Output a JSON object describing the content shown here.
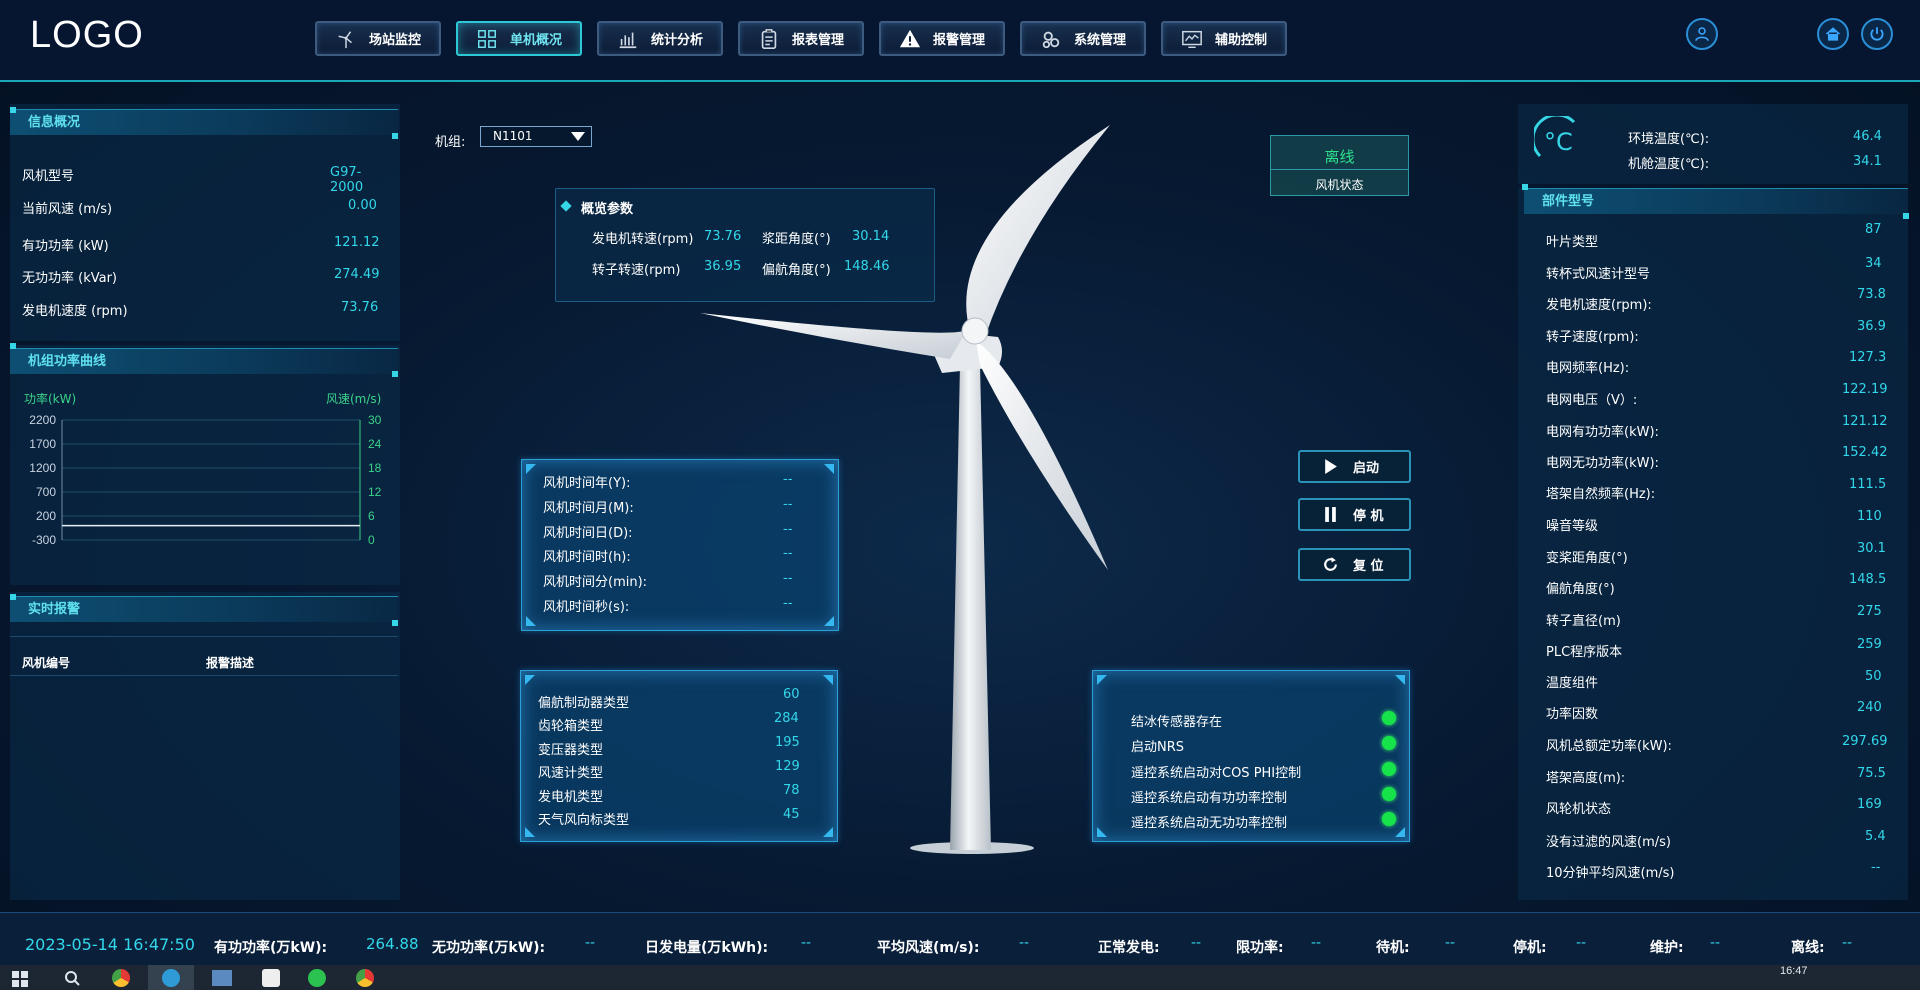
{
  "logo": "LOGO",
  "nav": [
    {
      "label": "场站监控",
      "icon": "wind-turbine-icon"
    },
    {
      "label": "单机概况",
      "icon": "grid-icon",
      "active": true
    },
    {
      "label": "统计分析",
      "icon": "bar-chart-icon"
    },
    {
      "label": "报表管理",
      "icon": "clipboard-icon"
    },
    {
      "label": "报警管理",
      "icon": "warning-icon"
    },
    {
      "label": "系统管理",
      "icon": "gears-icon"
    },
    {
      "label": "辅助控制",
      "icon": "monitor-chart-icon"
    }
  ],
  "info": {
    "title": "信息概况",
    "rows": [
      {
        "label": "风机型号",
        "value": "G97-2000"
      },
      {
        "label": "当前风速 (m/s)",
        "value": "0.00"
      },
      {
        "label": "有功功率 (kW)",
        "value": "121.12"
      },
      {
        "label": "无功功率 (kVar)",
        "value": "274.49"
      },
      {
        "label": "发电机速度 (rpm)",
        "value": "73.76"
      }
    ]
  },
  "power_curve": {
    "title": "机组功率曲线",
    "left_axis_label": "功率(kW)",
    "right_axis_label": "风速(m/s)"
  },
  "chart_data": {
    "type": "line",
    "title": "机组功率曲线",
    "ylabel": "功率(kW)",
    "y2label": "风速(m/s)",
    "yticks": [
      "2200",
      "1700",
      "1200",
      "700",
      "200",
      "-300"
    ],
    "y2ticks": [
      "30",
      "24",
      "18",
      "12",
      "6",
      "0"
    ],
    "ylim": [
      -300,
      2200
    ],
    "y2lim": [
      0,
      30
    ],
    "grid": true,
    "series": []
  },
  "alarm": {
    "title": "实时报警",
    "col_id": "风机编号",
    "col_desc": "报警描述"
  },
  "unit_select": {
    "label": "机组:",
    "value": "N1101"
  },
  "overview": {
    "title": "概览参数",
    "items": [
      {
        "label": "发电机转速(rpm)",
        "value": "73.76"
      },
      {
        "label": "浆距角度(°)",
        "value": "30.14"
      },
      {
        "label": "转子转速(rpm)",
        "value": "36.95"
      },
      {
        "label": "偏航角度(°)",
        "value": "148.46"
      }
    ]
  },
  "status": {
    "value": "离线",
    "label": "风机状态"
  },
  "time_box": [
    {
      "label": "风机时间年(Y):",
      "value": "--"
    },
    {
      "label": "风机时间月(M):",
      "value": "--"
    },
    {
      "label": "风机时间日(D):",
      "value": "--"
    },
    {
      "label": "风机时间时(h):",
      "value": "--"
    },
    {
      "label": "风机时间分(min):",
      "value": "--"
    },
    {
      "label": "风机时间秒(s):",
      "value": "--"
    }
  ],
  "types_box": [
    {
      "label": "偏航制动器类型",
      "value": "60"
    },
    {
      "label": "齿轮箱类型",
      "value": "284"
    },
    {
      "label": "变压器类型",
      "value": "195"
    },
    {
      "label": "风速计类型",
      "value": "129"
    },
    {
      "label": "发电机类型",
      "value": "78"
    },
    {
      "label": "天气风向标类型",
      "value": "45"
    }
  ],
  "controls": {
    "start": "启动",
    "stop": "停 机",
    "reset": "复 位"
  },
  "indicators": [
    {
      "label": "结冰传感器存在",
      "color": "#16e34a"
    },
    {
      "label": "启动NRS",
      "color": "#16e34a"
    },
    {
      "label": "遥控系统启动对COS PHI控制",
      "color": "#16e34a"
    },
    {
      "label": "遥控系统启动有功功率控制",
      "color": "#16e34a"
    },
    {
      "label": "遥控系统启动无功功率控制",
      "color": "#16e34a"
    }
  ],
  "temps": {
    "unit_symbol": "°C",
    "env_label": "环境温度(℃):",
    "env_value": "46.4",
    "cabin_label": "机舱温度(℃):",
    "cabin_value": "34.1"
  },
  "parts": {
    "title": "部件型号",
    "rows": [
      {
        "label": "叶片类型",
        "value": "87"
      },
      {
        "label": "转杯式风速计型号",
        "value": "34"
      },
      {
        "label": "发电机速度(rpm):",
        "value": "73.8"
      },
      {
        "label": "转子速度(rpm):",
        "value": "36.9"
      },
      {
        "label": "电网频率(Hz):",
        "value": "127.3"
      },
      {
        "label": "电网电压（V）:",
        "value": "122.19"
      },
      {
        "label": "电网有功功率(kW):",
        "value": "121.12"
      },
      {
        "label": "电网无功功率(kW):",
        "value": "152.42"
      },
      {
        "label": "塔架自然频率(Hz):",
        "value": "111.5"
      },
      {
        "label": "噪音等级",
        "value": "110"
      },
      {
        "label": "变桨距角度(°)",
        "value": "30.1"
      },
      {
        "label": "偏航角度(°)",
        "value": "148.5"
      },
      {
        "label": "转子直径(m)",
        "value": "275"
      },
      {
        "label": "PLC程序版本",
        "value": "259"
      },
      {
        "label": "温度组件",
        "value": "50"
      },
      {
        "label": "功率因数",
        "value": "240"
      },
      {
        "label": "风机总额定功率(kW):",
        "value": "297.69"
      },
      {
        "label": "塔架高度(m):",
        "value": "75.5"
      },
      {
        "label": "风轮机状态",
        "value": "169"
      },
      {
        "label": "没有过滤的风速(m/s)",
        "value": "5.4"
      },
      {
        "label": "10分钟平均风速(m/s)",
        "value": "--"
      }
    ]
  },
  "footer": {
    "datetime": "2023-05-14 16:47:50",
    "active_label": "有功功率(万kW):",
    "active_value": "264.88",
    "reactive_label": "无功功率(万kW):",
    "reactive_value": "--",
    "daily_label": "日发电量(万kWh):",
    "daily_value": "--",
    "wind_label": "平均风速(m/s):",
    "wind_value": "--",
    "normal_label": "正常发电:",
    "normal_value": "--",
    "limit_label": "限功率:",
    "limit_value": "--",
    "standby_label": "待机:",
    "standby_value": "--",
    "stop_label": "停机:",
    "stop_value": "--",
    "maint_label": "维护:",
    "maint_value": "--",
    "offline_label": "离线:",
    "offline_value": "--"
  },
  "taskbar": {
    "time": "16:47"
  }
}
